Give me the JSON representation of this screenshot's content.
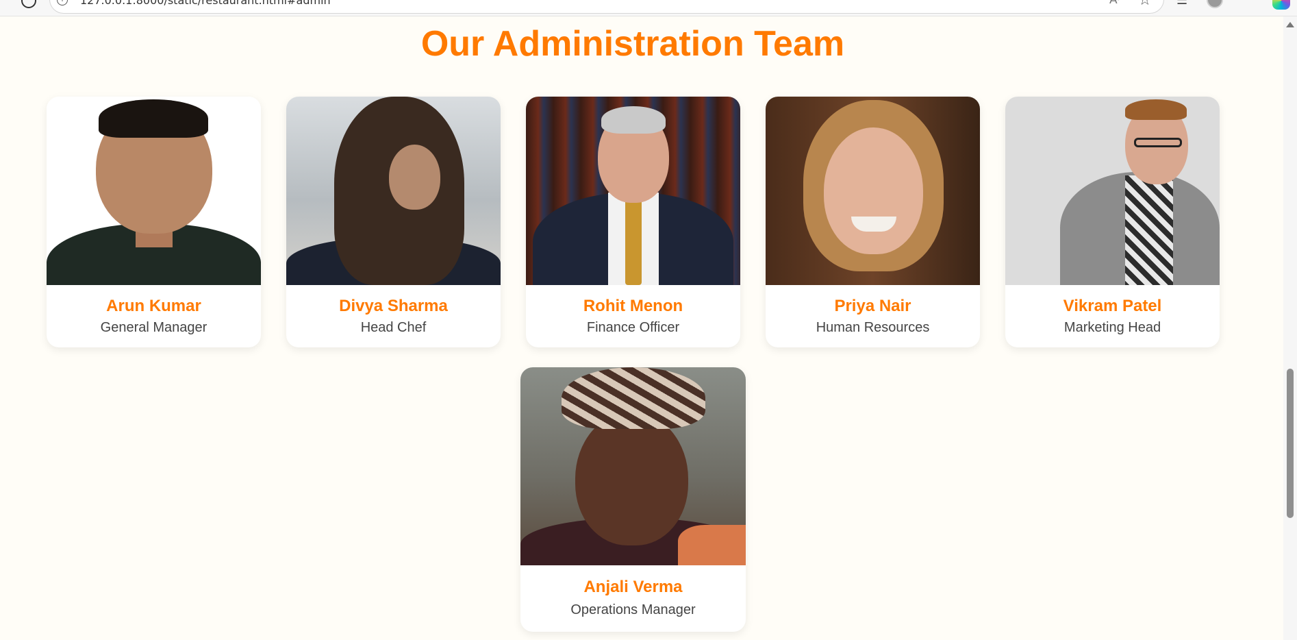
{
  "browser": {
    "url": "127.0.0.1:8000/static/restaurant.html#admin"
  },
  "section": {
    "title": "Our Administration Team"
  },
  "team": [
    {
      "name": "Arun Kumar",
      "role": "General Manager"
    },
    {
      "name": "Divya Sharma",
      "role": "Head Chef"
    },
    {
      "name": "Rohit Menon",
      "role": "Finance Officer"
    },
    {
      "name": "Priya Nair",
      "role": "Human Resources"
    },
    {
      "name": "Vikram Patel",
      "role": "Marketing Head"
    },
    {
      "name": "Anjali Verma",
      "role": "Operations Manager"
    }
  ],
  "colors": {
    "accent": "#ff7a00",
    "page_background": "#fffdf7",
    "card_background": "#ffffff",
    "role_text": "#444444"
  },
  "icons": [
    "reload-icon",
    "site-info-icon",
    "read-aloud-icon",
    "favorite-star-icon",
    "favorites-icon",
    "profile-avatar-icon",
    "more-menu-icon",
    "copilot-icon",
    "scroll-up-arrow-icon"
  ]
}
